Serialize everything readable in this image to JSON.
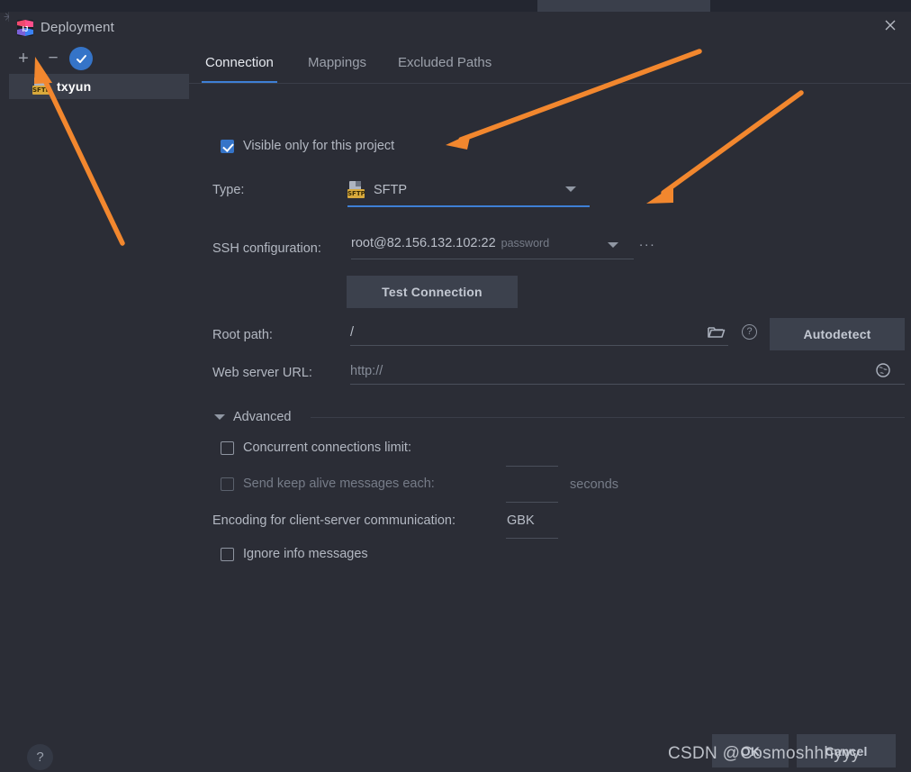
{
  "window": {
    "title": "Deployment",
    "close_icon": "close-icon",
    "app_icon": "intellij-idea-icon"
  },
  "sidebar": {
    "toolbar": {
      "add_label": "+",
      "remove_label": "−",
      "validate_icon": "checkmark-icon"
    },
    "items": [
      {
        "label": "txyun",
        "icon": "sftp-server-icon",
        "selected": true
      }
    ]
  },
  "tabs": [
    {
      "label": "Connection",
      "active": true
    },
    {
      "label": "Mappings",
      "active": false
    },
    {
      "label": "Excluded Paths",
      "active": false
    }
  ],
  "form": {
    "visible_only_checkbox": {
      "label": "Visible only for this project",
      "checked": true
    },
    "type": {
      "label": "Type:",
      "value": "SFTP",
      "icon": "sftp-type-icon",
      "dropdown_icon": "chevron-down-icon"
    },
    "ssh_configuration": {
      "label": "SSH configuration:",
      "value": "root@82.156.132.102:22",
      "value_suffix": "password",
      "dropdown_icon": "chevron-down-icon",
      "more_label": "..."
    },
    "test_connection_button": "Test Connection",
    "root_path": {
      "label": "Root path:",
      "value": "/",
      "browse_icon": "folder-icon",
      "help_icon": "question-mark-icon",
      "autodetect_button": "Autodetect"
    },
    "web_server_url": {
      "label": "Web server URL:",
      "value": "http://",
      "open_icon": "globe-icon"
    },
    "advanced": {
      "label": "Advanced",
      "collapse_icon": "triangle-down-icon",
      "concurrent_connections": {
        "label": "Concurrent connections limit:",
        "checked": false,
        "value": ""
      },
      "keep_alive": {
        "label": "Send keep alive messages each:",
        "checked": false,
        "value": "",
        "unit": "seconds",
        "disabled": true
      },
      "encoding": {
        "label": "Encoding for client-server communication:",
        "value": "GBK"
      },
      "ignore_info": {
        "label": "Ignore info messages",
        "checked": false
      }
    }
  },
  "footer": {
    "help_label": "?",
    "ok_label": "OK",
    "cancel_label": "Cancel"
  },
  "watermark": "CSDN @Cosmoshhhyyy",
  "colors": {
    "background": "#2b2d36",
    "accent_blue": "#3e7fd5",
    "checkbox_blue": "#3574c8",
    "annotation_orange": "#f2872e",
    "selected_row": "#393d48"
  },
  "annotations": [
    {
      "name": "arrow-to-type-dropdown",
      "color": "#f2872e"
    },
    {
      "name": "arrow-to-ssh-more-button",
      "color": "#f2872e"
    },
    {
      "name": "arrow-to-add-button",
      "color": "#f2872e"
    }
  ]
}
